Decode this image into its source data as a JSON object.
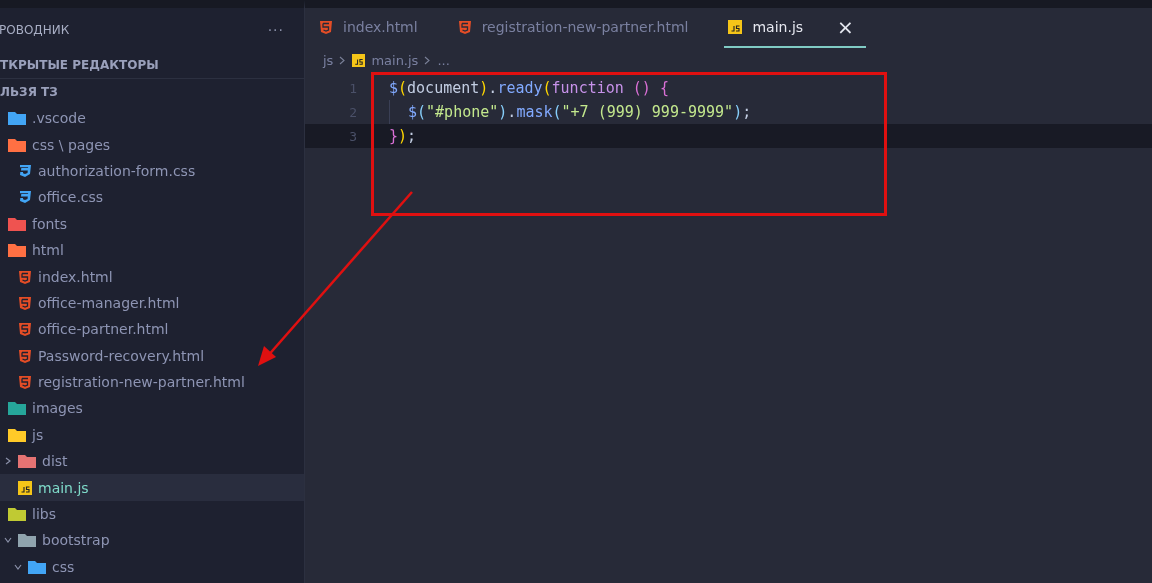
{
  "sidebar": {
    "title": "РОВОДНИК",
    "more": "···",
    "sections": [
      {
        "title": "ТКРЫТЫЕ РЕДАКТОРЫ"
      },
      {
        "title": "ЛЬЗЯ ТЗ"
      }
    ],
    "tree": [
      {
        "name": ".vscode",
        "kind": "folder-vscode",
        "selected": false
      },
      {
        "name": "css \\ pages",
        "kind": "folder-css",
        "selected": false,
        "children": [
          {
            "name": "authorization-form.css",
            "kind": "css",
            "selected": false
          },
          {
            "name": "office.css",
            "kind": "css",
            "selected": false
          }
        ]
      },
      {
        "name": "fonts",
        "kind": "folder-fonts",
        "selected": false
      },
      {
        "name": "html",
        "kind": "folder-html",
        "selected": false,
        "children": [
          {
            "name": "index.html",
            "kind": "html",
            "selected": false
          },
          {
            "name": "office-manager.html",
            "kind": "html",
            "selected": false
          },
          {
            "name": "office-partner.html",
            "kind": "html",
            "selected": false
          },
          {
            "name": "Password-recovery.html",
            "kind": "html",
            "selected": false
          },
          {
            "name": "registration-new-partner.html",
            "kind": "html",
            "selected": false
          }
        ]
      },
      {
        "name": "images",
        "kind": "folder-images",
        "selected": false
      },
      {
        "name": "js",
        "kind": "folder-js",
        "selected": false,
        "children": [
          {
            "name": "dist",
            "kind": "folder-dist",
            "expanded": false,
            "selected": false
          },
          {
            "name": "main.js",
            "kind": "js",
            "selected": true
          }
        ]
      },
      {
        "name": "libs",
        "kind": "folder-libs",
        "selected": false,
        "children": [
          {
            "name": "bootstrap",
            "kind": "folder",
            "expanded": true,
            "selected": false,
            "children": [
              {
                "name": "css",
                "kind": "folder-css-blue",
                "expanded": true,
                "selected": false
              }
            ]
          }
        ]
      }
    ]
  },
  "tabs": [
    {
      "label": "index.html",
      "kind": "html",
      "selected": false
    },
    {
      "label": "registration-new-partner.html",
      "kind": "html",
      "selected": false
    },
    {
      "label": "main.js",
      "kind": "js",
      "selected": true,
      "close": "×"
    }
  ],
  "breadcrumb": [
    {
      "text": "js"
    },
    {
      "text": "main.js",
      "kind": "js"
    },
    {
      "text": "..."
    }
  ],
  "code": [
    {
      "number": "1",
      "kind": "plain",
      "current": false,
      "tokens": [
        {
          "text": "$",
          "kind": "fn"
        },
        {
          "text": "(",
          "kind": "paren1"
        },
        {
          "text": "document",
          "kind": "plain"
        },
        {
          "text": ")",
          "kind": "paren1"
        },
        {
          "text": ".",
          "kind": "plain"
        },
        {
          "text": "ready",
          "kind": "fn"
        },
        {
          "text": "(",
          "kind": "paren1"
        },
        {
          "text": "function",
          "kind": "keyword"
        },
        {
          "text": "()",
          "kind": "paren2"
        },
        {
          "text": "{",
          "kind": "paren2"
        }
      ]
    },
    {
      "number": "2",
      "kind": "indented",
      "current": false,
      "tokens": [
        {
          "text": "$",
          "kind": "fn"
        },
        {
          "text": "(",
          "kind": "paren3"
        },
        {
          "text": "\"#phone\"",
          "kind": "string"
        },
        {
          "text": ")",
          "kind": "paren3"
        },
        {
          "text": ".",
          "kind": "plain"
        },
        {
          "text": "mask",
          "kind": "fn"
        },
        {
          "text": "(",
          "kind": "paren3"
        },
        {
          "text": "\"+7 (999) 999-9999\"",
          "kind": "string"
        },
        {
          "text": ")",
          "kind": "paren3"
        },
        {
          "text": ";",
          "kind": "plain"
        }
      ]
    },
    {
      "number": "3",
      "kind": "plain",
      "current": true,
      "tokens": [
        {
          "text": "}",
          "kind": "paren2"
        },
        {
          "text": ")",
          "kind": "paren1"
        },
        {
          "text": ";",
          "kind": "plain"
        }
      ]
    }
  ]
}
